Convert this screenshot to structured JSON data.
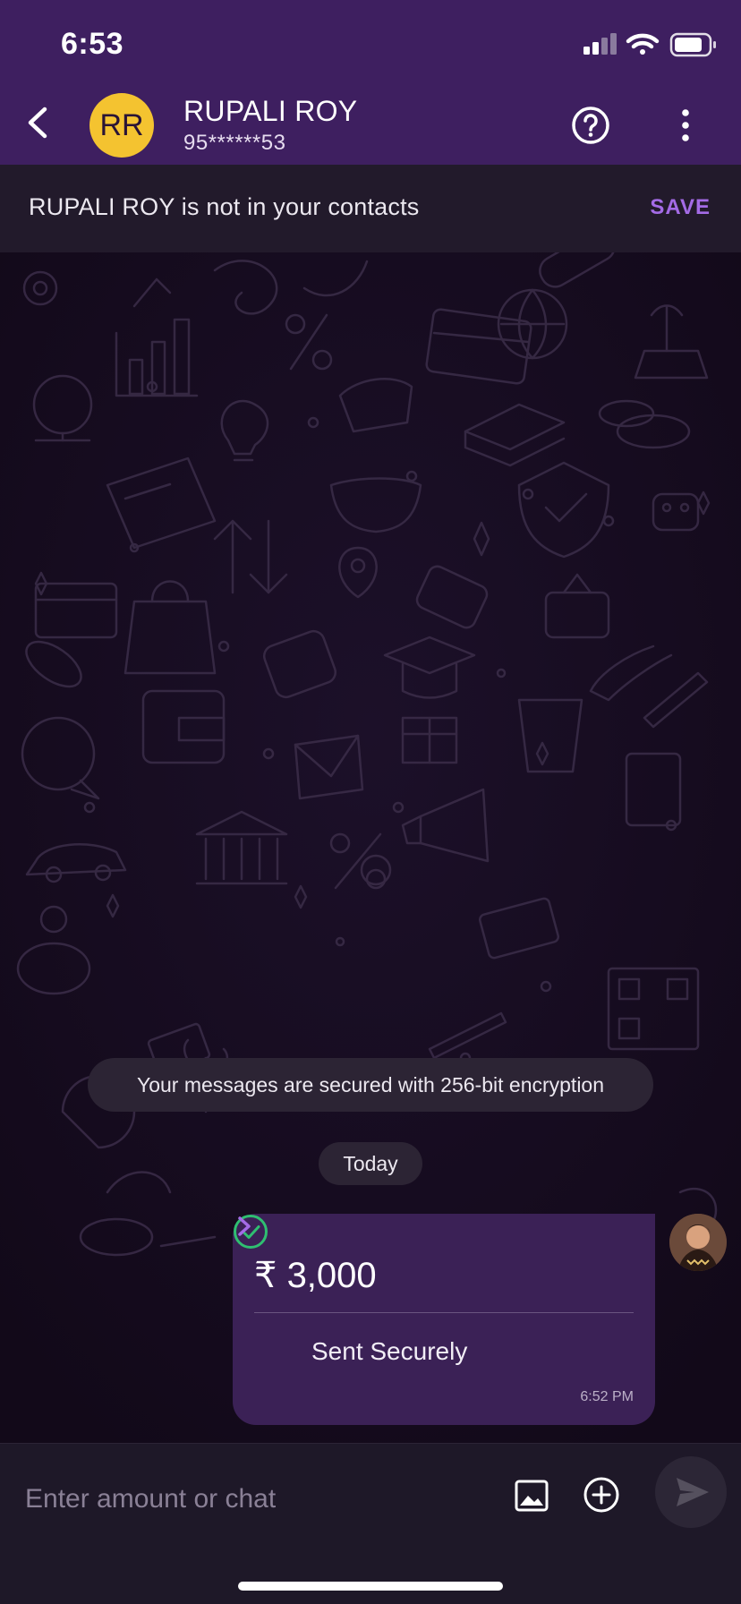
{
  "status_bar": {
    "time": "6:53"
  },
  "header": {
    "avatar_initials": "RR",
    "contact_name": "RUPALI ROY",
    "contact_phone": "95******53"
  },
  "banner": {
    "text": "RUPALI ROY is not in your contacts",
    "save_label": "SAVE"
  },
  "chat": {
    "encryption_notice": "Your messages are secured with 256-bit encryption",
    "date_label": "Today",
    "payment": {
      "amount": "₹ 3,000",
      "status": "Sent Securely",
      "time": "6:52 PM"
    }
  },
  "input": {
    "placeholder": "Enter amount or chat"
  },
  "colors": {
    "header_bg": "#3e1f60",
    "accent": "#a46be6",
    "avatar_bg": "#f4c330",
    "success": "#2fbf71",
    "bubble_bg": "#3b2156"
  },
  "icons": [
    "back-arrow-icon",
    "help-icon",
    "more-vertical-icon",
    "check-circle-icon",
    "chevron-right-icon",
    "gallery-icon",
    "add-circle-icon",
    "send-icon",
    "signal-icon",
    "wifi-icon",
    "battery-icon"
  ]
}
